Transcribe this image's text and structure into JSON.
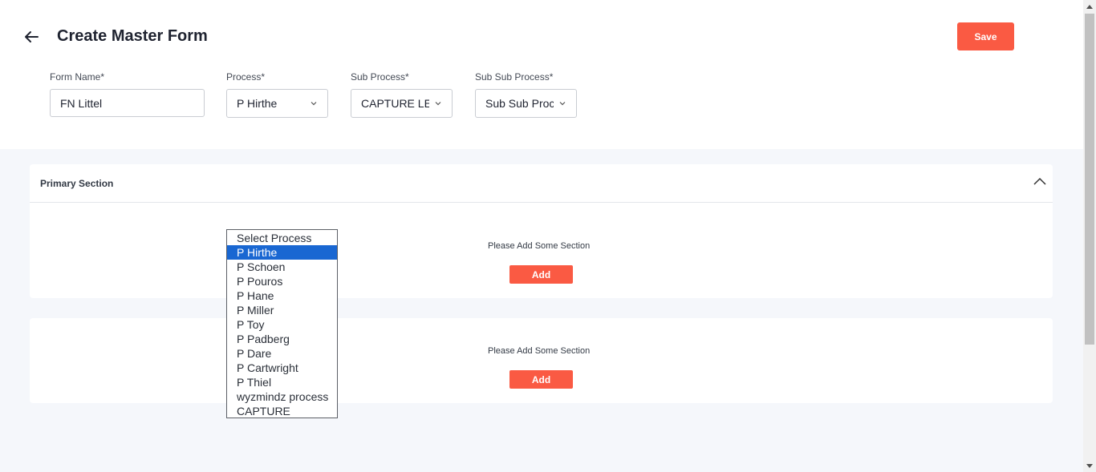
{
  "header": {
    "title": "Create Master Form",
    "save_label": "Save"
  },
  "form": {
    "form_name_label": "Form Name*",
    "form_name_value": "FN Littel",
    "process_label": "Process*",
    "process_value": "P Hirthe",
    "sub_process_label": "Sub Process*",
    "sub_process_value": "CAPTURE LE",
    "sub_sub_process_label": "Sub Sub Process*",
    "sub_sub_process_value": "Sub Sub Proc"
  },
  "primary_section": {
    "title": "Primary Section",
    "empty_text": "Please Add Some Section",
    "add_label": "Add"
  },
  "secondary_section": {
    "empty_text": "Please Add Some Section",
    "add_label": "Add"
  },
  "process_dropdown": {
    "options": [
      "Select Process",
      "P Hirthe",
      "P Schoen",
      "P Pouros",
      "P Hane",
      "P Miller",
      "P Toy",
      "P Padberg",
      "P Dare",
      "P Cartwright",
      "P Thiel",
      "wyzmindz process",
      "CAPTURE"
    ],
    "selected_index": 1
  },
  "colors": {
    "accent": "#fa5a43",
    "selected_option": "#1967d2",
    "content_bg": "#f5f7fb"
  },
  "icons": {
    "back": "arrow-left-icon",
    "chevron": "chevron-down-icon",
    "collapse": "chevron-up-icon"
  }
}
